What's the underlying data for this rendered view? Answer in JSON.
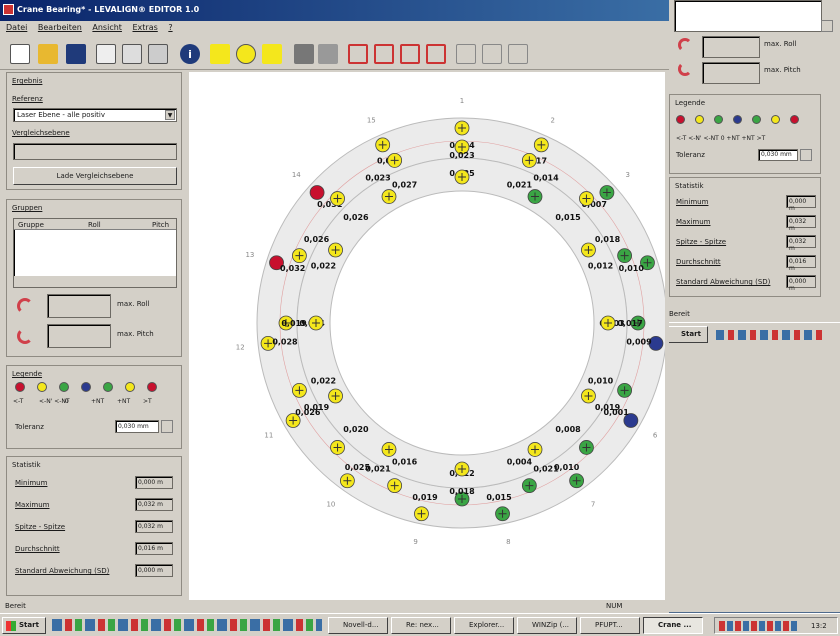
{
  "window": {
    "title": "Crane Bearing* - LEVALIGN® EDITOR 1.0",
    "menu": [
      "Datei",
      "Bearbeiten",
      "Ansicht",
      "Extras",
      "?"
    ]
  },
  "sidebar": {
    "ergebnis_label": "Ergebnis",
    "referenz_label": "Referenz",
    "referenz_value": "Laser Ebene - alle positiv",
    "vergleichsebene_label": "Vergleichsebene",
    "lade_button": "Lade Vergleichsebene",
    "gruppen_label": "Gruppen",
    "table_headers": [
      "Gruppe",
      "Roll",
      "Pitch"
    ],
    "max_roll": "max. Roll",
    "max_pitch": "max. Pitch",
    "legende_label": "Legende",
    "legende_items": [
      "<-T",
      "<-N' <-NT",
      "0",
      "+NT",
      "+NT",
      ">T"
    ],
    "toleranz_label": "Toleranz",
    "toleranz_value": "0,030 mm",
    "statistik_label": "Statistik",
    "statistik": [
      {
        "label": "Minimum",
        "value": "0,000 m"
      },
      {
        "label": "Maximum",
        "value": "0,032 m"
      },
      {
        "label": "Spitze - Spitze",
        "value": "0,032 m"
      },
      {
        "label": "Durchschnitt",
        "value": "0,016 m"
      },
      {
        "label": "Standard Abweichung (SD)",
        "value": "0,000 m"
      }
    ]
  },
  "right_window": {
    "max_roll": "max. Roll",
    "max_pitch": "max. Pitch",
    "legende_label": "Legende",
    "legende_items": "<-T <-N' <-NT 0 +NT +NT >T",
    "toleranz_label": "Toleranz",
    "toleranz_value": "0,030 mm",
    "statistik_label": "Statistik",
    "statistik": [
      {
        "label": "Minimum",
        "value": "0,000 m"
      },
      {
        "label": "Maximum",
        "value": "0,032 m"
      },
      {
        "label": "Spitze - Spitze",
        "value": "0,032 m"
      },
      {
        "label": "Durchschnitt",
        "value": "0,016 m"
      },
      {
        "label": "Standard Abweichung (SD)",
        "value": "0,000 m"
      }
    ],
    "status": "Bereit"
  },
  "status": {
    "left": "Bereit",
    "right": "NUM"
  },
  "taskbar": {
    "start": "Start",
    "tasks": [
      "Novell-d...",
      "Re: nex...",
      "Explorer...",
      "WINZip (...",
      "PFUPT...",
      "Crane ..."
    ],
    "clock": "13:2"
  },
  "colors": {
    "red": "#c8102e",
    "yellow": "#f4e71c",
    "green": "#3aa544",
    "blue": "#2b3a8f"
  },
  "diagram": {
    "outer_ring": [
      {
        "n": "1",
        "value": "0,024",
        "color": "yellow"
      },
      {
        "n": "2",
        "value": "0,017",
        "color": "yellow"
      },
      {
        "n": "3",
        "value": "0,007",
        "color": "green"
      },
      {
        "n": "4",
        "value": "0,010",
        "color": "green"
      },
      {
        "n": "5",
        "value": "0,009",
        "color": "blue"
      },
      {
        "n": "6",
        "value": "0,001",
        "color": "blue"
      },
      {
        "n": "7",
        "value": "0,010",
        "color": "green"
      },
      {
        "n": "8",
        "value": "0,015",
        "color": "green"
      },
      {
        "n": "9",
        "value": "0,019",
        "color": "yellow"
      },
      {
        "n": "10",
        "value": "0,025",
        "color": "yellow"
      },
      {
        "n": "11",
        "value": "0,026",
        "color": "yellow"
      },
      {
        "n": "12",
        "value": "0,028",
        "color": "yellow"
      },
      {
        "n": "13",
        "value": "0,032",
        "color": "red"
      },
      {
        "n": "14",
        "value": "0,031",
        "color": "red"
      },
      {
        "n": "15",
        "value": "0,026",
        "color": "yellow"
      }
    ],
    "middle_ring": [
      {
        "value": "0,025",
        "color": "yellow"
      },
      {
        "value": "0,021",
        "color": "yellow"
      },
      {
        "value": "0,015",
        "color": "yellow"
      },
      {
        "value": "0,012",
        "color": "green"
      },
      {
        "value": "0,003",
        "color": "green"
      },
      {
        "value": "0,010",
        "color": "green"
      },
      {
        "value": "0,008",
        "color": "green"
      },
      {
        "value": "0,004",
        "color": "green"
      },
      {
        "value": "0,012",
        "color": "green"
      },
      {
        "value": "0,016",
        "color": "yellow"
      },
      {
        "value": "0,020",
        "color": "yellow"
      },
      {
        "value": "0,022",
        "color": "yellow"
      },
      {
        "value": "0,024",
        "color": "yellow"
      },
      {
        "value": "0,022",
        "color": "yellow"
      },
      {
        "value": "0,026",
        "color": "yellow"
      },
      {
        "value": "0,027",
        "color": "yellow"
      }
    ],
    "inner_ring": [
      {
        "value": "0,023",
        "color": "yellow"
      },
      {
        "value": "0,014",
        "color": "green"
      },
      {
        "value": "0,018",
        "color": "yellow"
      },
      {
        "value": "0,017",
        "color": "yellow"
      },
      {
        "value": "0,019",
        "color": "yellow"
      },
      {
        "value": "0,021",
        "color": "yellow"
      },
      {
        "value": "0,018",
        "color": "yellow"
      },
      {
        "value": "0,021",
        "color": "yellow"
      },
      {
        "value": "0,019",
        "color": "yellow"
      },
      {
        "value": "0,019",
        "color": "yellow"
      },
      {
        "value": "0,026",
        "color": "yellow"
      },
      {
        "value": "0,023",
        "color": "yellow"
      }
    ]
  }
}
